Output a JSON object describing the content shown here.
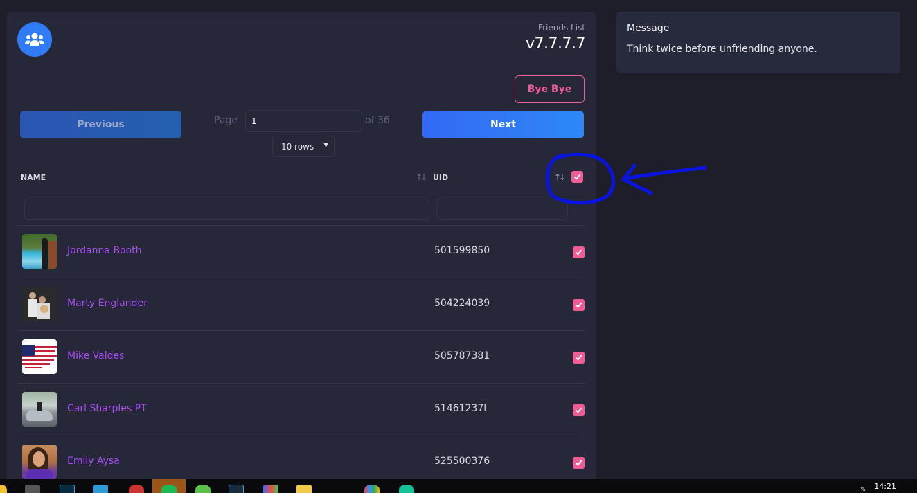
{
  "app": {
    "subtitle": "Friends List",
    "version": "v7.7.7.7",
    "logo_icon": "users-group-icon"
  },
  "actions": {
    "bye_label": "Bye Bye",
    "previous_label": "Previous",
    "next_label": "Next"
  },
  "pagination": {
    "page_label": "Page",
    "page_value": "1",
    "of_label": "of 36",
    "rows_selected": "10 rows"
  },
  "table": {
    "columns": [
      {
        "label": "NAME",
        "sort_icon": "sort-arrows-icon"
      },
      {
        "label": "UID",
        "sort_icon": "sort-arrows-icon"
      }
    ],
    "select_all_checked": true,
    "filters": {
      "name_value": "",
      "uid_value": ""
    },
    "rows": [
      {
        "name": "Jordanna Booth",
        "uid": "501599850",
        "checked": true,
        "avatar": "photo-pool"
      },
      {
        "name": "Marty Englander",
        "uid": "504224039",
        "checked": true,
        "avatar": "photo-couple-dog"
      },
      {
        "name": "Mike Valdes",
        "uid": "505787381",
        "checked": true,
        "avatar": "us-flag"
      },
      {
        "name": "Carl Sharples PT",
        "uid": "51461237l",
        "checked": true,
        "avatar": "photo-car"
      },
      {
        "name": "Emily Aysa",
        "uid": "525500376",
        "checked": true,
        "avatar": "photo-woman"
      }
    ]
  },
  "message": {
    "title": "Message",
    "body": "Think twice before unfriending anyone."
  },
  "colors": {
    "accent_blue": "#2f7cf6",
    "accent_pink": "#f05d95",
    "name_purple": "#a64df0",
    "annotation_blue": "#0a14e0"
  },
  "taskbar": {
    "clock": "14:21"
  }
}
